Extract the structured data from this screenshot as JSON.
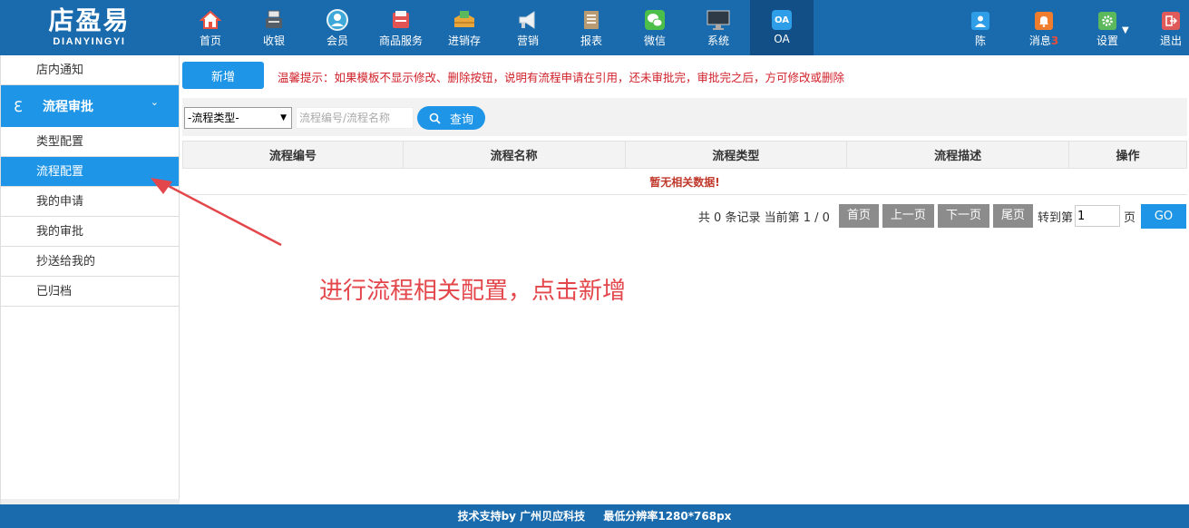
{
  "logo": {
    "title": "店盈易",
    "subtitle": "DIANYINGYI"
  },
  "nav": [
    {
      "label": "首页",
      "icon": "home-icon",
      "color": "#e8523f"
    },
    {
      "label": "收银",
      "icon": "cash-register-icon",
      "color": "#555d66"
    },
    {
      "label": "会员",
      "icon": "member-icon",
      "color": "#3ea9d8"
    },
    {
      "label": "商品服务",
      "icon": "goods-icon",
      "color": "#e25353"
    },
    {
      "label": "进销存",
      "icon": "inventory-icon",
      "color": "#e9a63c"
    },
    {
      "label": "营销",
      "icon": "megaphone-icon",
      "color": "#eef2f5"
    },
    {
      "label": "报表",
      "icon": "report-icon",
      "color": "#b89a73"
    },
    {
      "label": "微信",
      "icon": "wechat-icon",
      "color": "#4cbf4a"
    },
    {
      "label": "系统",
      "icon": "monitor-icon",
      "color": "#2e3a46"
    },
    {
      "label": "OA",
      "icon": "oa-icon",
      "color": "#2e9ee8"
    }
  ],
  "user_nav": {
    "user": {
      "label": "陈",
      "icon": "user-icon",
      "color": "#2e9ee8"
    },
    "messages": {
      "label": "消息",
      "badge": "3",
      "icon": "bell-icon",
      "color": "#f07d2e"
    },
    "settings": {
      "label": "设置",
      "icon": "gear-icon",
      "color": "#5cb85c"
    },
    "logout": {
      "label": "退出",
      "icon": "logout-icon",
      "color": "#e05a5a"
    }
  },
  "sidebar": {
    "notice": "店内通知",
    "group": "流程审批",
    "items": [
      "类型配置",
      "流程配置",
      "我的申请",
      "我的审批",
      "抄送给我的",
      "已归档"
    ],
    "active_item": "流程配置"
  },
  "main": {
    "add_label": "新增",
    "tip": "温馨提示：如果模板不显示修改、删除按钮，说明有流程申请在引用，还未审批完，审批完之后，方可修改或删除",
    "type_select_value": "-流程类型-",
    "search_placeholder": "流程编号/流程名称",
    "query_label": "查询",
    "columns": [
      "流程编号",
      "流程名称",
      "流程类型",
      "流程描述",
      "操作"
    ],
    "empty_text": "暂无相关数据!"
  },
  "pager": {
    "info": "共 0 条记录 当前第 1 / 0",
    "first": "首页",
    "prev": "上一页",
    "next": "下一页",
    "last": "尾页",
    "goto": "转到第",
    "page_value": "1",
    "page_unit": "页",
    "go": "GO"
  },
  "annotation": {
    "text": "进行流程相关配置，点击新增",
    "color": "#e3474b"
  },
  "footer": {
    "support": "技术支持by 广州贝应科技",
    "resolution": "最低分辨率1280*768px"
  }
}
